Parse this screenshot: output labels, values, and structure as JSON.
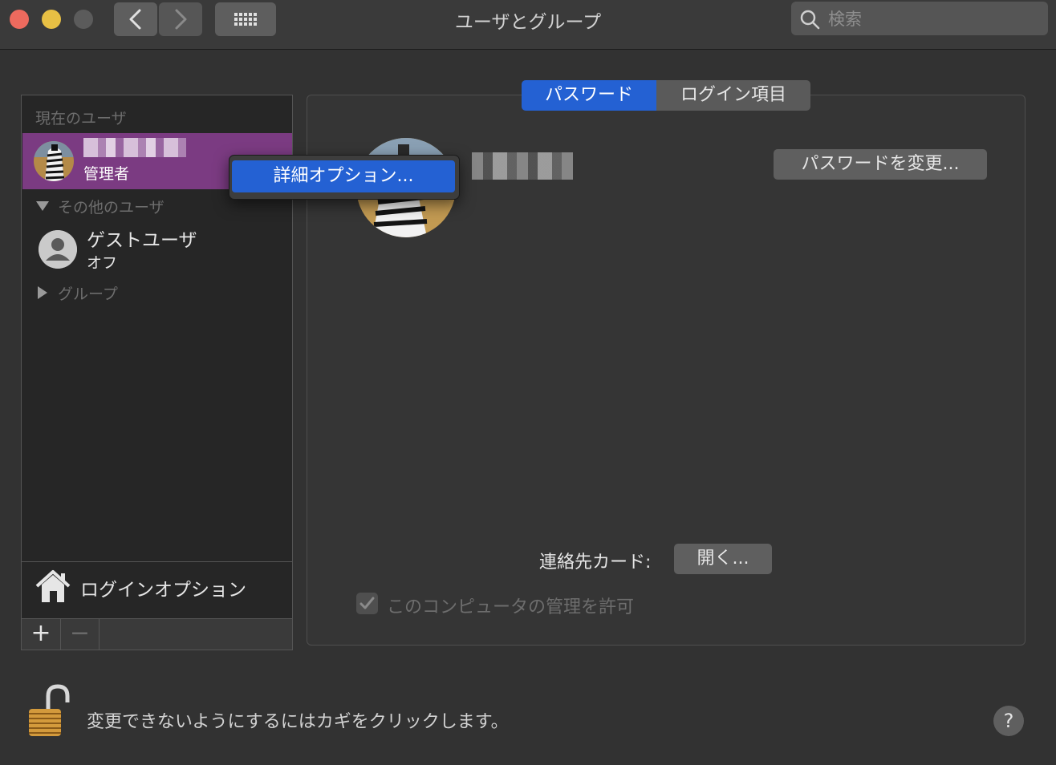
{
  "window": {
    "title": "ユーザとグループ"
  },
  "toolbar": {
    "search_placeholder": "検索"
  },
  "sidebar": {
    "current_users_header": "現在のユーザ",
    "current_user": {
      "role": "管理者"
    },
    "other_users_header": "その他のユーザ",
    "guest": {
      "name": "ゲストユーザ",
      "status": "オフ"
    },
    "groups_header": "グループ",
    "login_options": "ログインオプション",
    "add_label": "+",
    "remove_label": "−"
  },
  "tabs": [
    {
      "label": "パスワード",
      "selected": true
    },
    {
      "label": "ログイン項目",
      "selected": false
    }
  ],
  "main": {
    "change_password_button": "パスワードを変更...",
    "contact_card_label": "連絡先カード:",
    "open_button": "開く...",
    "allow_admin_label": "このコンピュータの管理を許可",
    "allow_admin_checked": true
  },
  "context_menu": {
    "item": "詳細オプション..."
  },
  "footer": {
    "lock_message": "変更できないようにするにはカギをクリックします。",
    "help_label": "?"
  },
  "colors": {
    "accent": "#2461d3",
    "selected_row": "#7b3b82",
    "window_bg": "#323232"
  }
}
